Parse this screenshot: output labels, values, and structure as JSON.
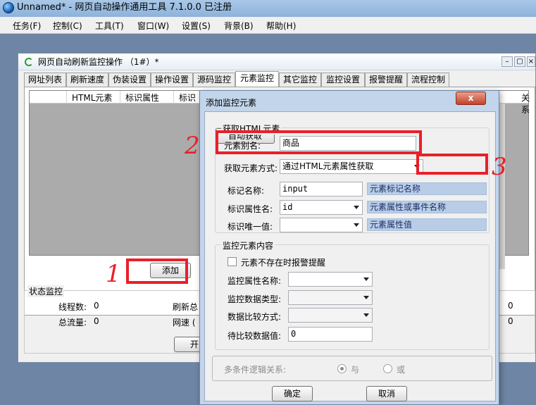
{
  "app": {
    "title": "Unnamed* - 网页自动操作通用工具 7.1.0.0  已注册",
    "menus": [
      "任务(F)",
      "控制(C)",
      "工具(T)",
      "窗口(W)",
      "设置(S)",
      "背景(B)",
      "帮助(H)"
    ]
  },
  "child_window": {
    "title": "网页自动刷新监控操作 （1#）*",
    "tabs": [
      "网址列表",
      "刷新速度",
      "伪装设置",
      "操作设置",
      "源码监控",
      "元素监控",
      "其它监控",
      "监控设置",
      "报警提醒",
      "流程控制"
    ],
    "active_tab": "元素监控",
    "columns": [
      "HTML元素",
      "标识属性",
      "标识",
      "关系"
    ],
    "add_button": "添加",
    "status": {
      "group_title": "状态监控",
      "threads_label": "线程数:",
      "threads_value": "0",
      "traffic_label": "总流量:",
      "traffic_value": "0",
      "refresh_label": "刷新总",
      "speed_label": "网速 (",
      "right_value_1": "0",
      "right_value_2": "0",
      "start_button": "开"
    }
  },
  "dialog": {
    "title": "添加监控元素",
    "close_label": "x",
    "get_group": {
      "title": "获取HTML元素",
      "alias_label": "元素别名:",
      "alias_value": "商品",
      "method_label": "获取元素方式:",
      "method_value": "通过HTML元素属性获取",
      "auto_button": "自动获取",
      "tag_label": "标记名称:",
      "tag_value": "input",
      "tag_hint": "元素标记名称",
      "attr_label": "标识属性名:",
      "attr_value": "id",
      "attr_hint": "元素属性或事件名称",
      "unique_label": "标识唯一值:",
      "unique_value": "",
      "unique_hint": "元素属性值"
    },
    "monitor_group": {
      "title": "监控元素内容",
      "alarm_checkbox": "元素不存在时报警提醒",
      "attr_name_label": "监控属性名称:",
      "data_type_label": "监控数据类型:",
      "compare_label": "数据比较方式:",
      "compare_value_label": "待比较数据值:",
      "compare_value": "0"
    },
    "logic": {
      "label": "多条件逻辑关系:",
      "and_label": "与",
      "or_label": "或",
      "selected": "与"
    },
    "ok_button": "确定",
    "cancel_button": "取消"
  },
  "annotations": {
    "marker_1": "1",
    "marker_2": "2",
    "marker_3": "3",
    "color": "#e8202a"
  }
}
